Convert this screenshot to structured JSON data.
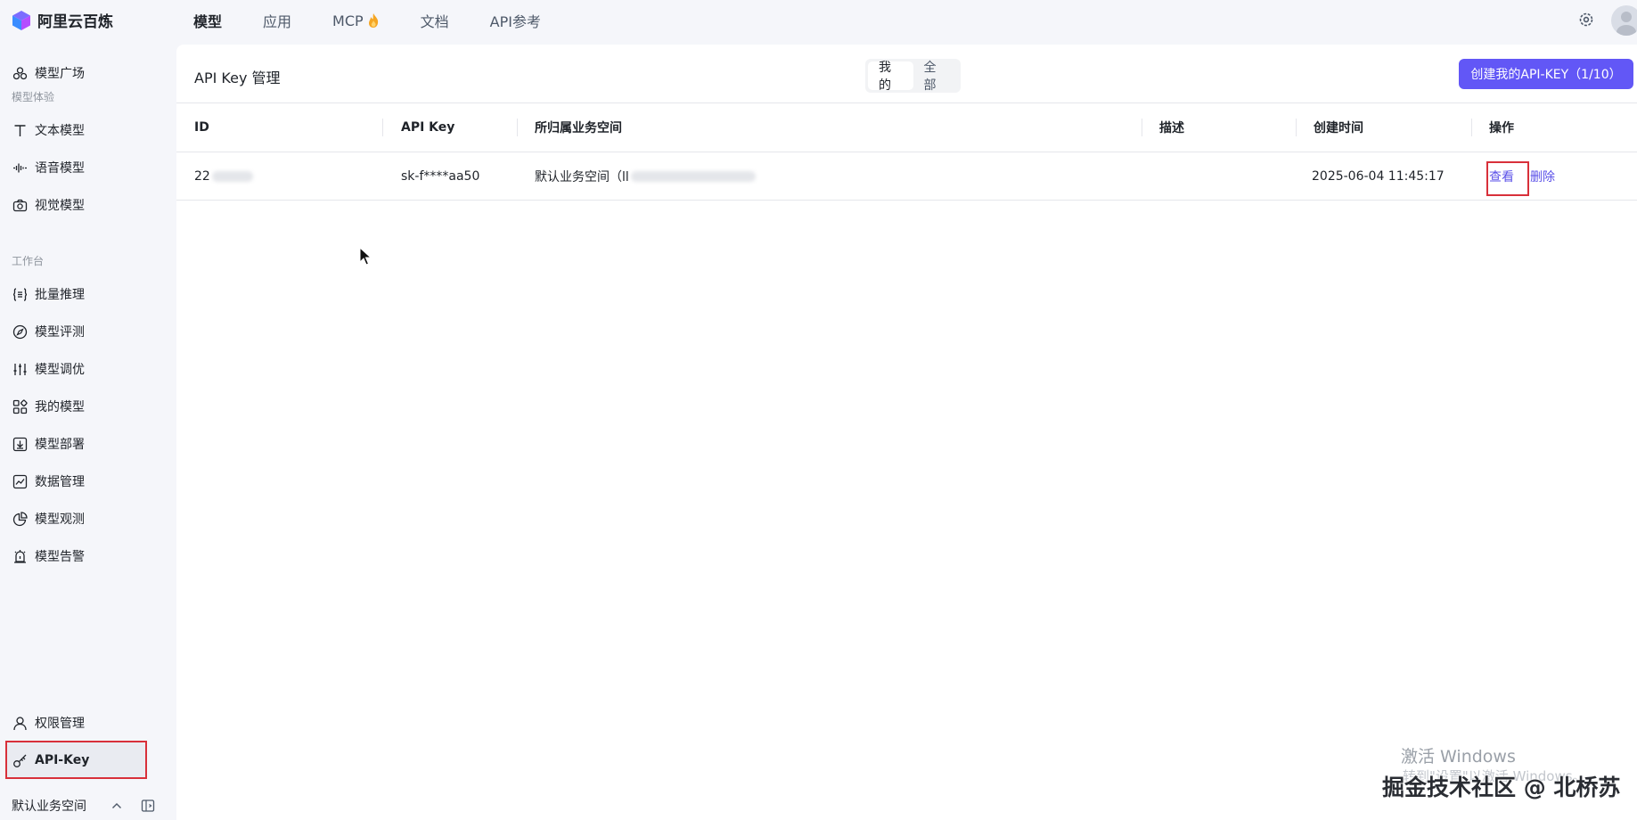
{
  "app": {
    "brand_name": "阿里云百炼",
    "accent_color": "#6257f6"
  },
  "top_nav": {
    "items": [
      {
        "label": "模型",
        "active": true
      },
      {
        "label": "应用",
        "active": false
      },
      {
        "label": "MCP",
        "active": false,
        "icon": "flame-icon"
      },
      {
        "label": "文档",
        "active": false
      },
      {
        "label": "API参考",
        "active": false
      }
    ]
  },
  "sidebar": {
    "model_square": "模型广场",
    "section_experience": "模型体验",
    "text_model": "文本模型",
    "voice_model": "语音模型",
    "vision_model": "视觉模型",
    "section_workbench": "工作台",
    "batch_inference": "批量推理",
    "model_eval": "模型评测",
    "model_tuning": "模型调优",
    "my_models": "我的模型",
    "model_deploy": "模型部署",
    "data_manage": "数据管理",
    "model_observe": "模型观测",
    "model_alert": "模型告警",
    "permission": "权限管理",
    "api_key": "API-Key",
    "workspace": "默认业务空间"
  },
  "main": {
    "title": "API Key 管理",
    "segment": {
      "mine": "我的",
      "all": "全部",
      "selected": "我的"
    },
    "create_button": "创建我的API-KEY（1/10）",
    "table": {
      "headers": [
        "ID",
        "API Key",
        "所归属业务空间",
        "描述",
        "创建时间",
        "操作"
      ],
      "rows": [
        {
          "id": "22",
          "api_key": "sk-f****aa50",
          "workspace": "默认业务空间（ll",
          "description": "",
          "created": "2025-06-04 11:45:17",
          "action_view": "查看",
          "action_delete": "删除"
        }
      ]
    }
  },
  "watermarks": {
    "windows_activate": "激活 Windows",
    "windows_sub": "转到\"设置\"以激活 Windows。",
    "site": "掘金技术社区 @ 北桥苏"
  }
}
